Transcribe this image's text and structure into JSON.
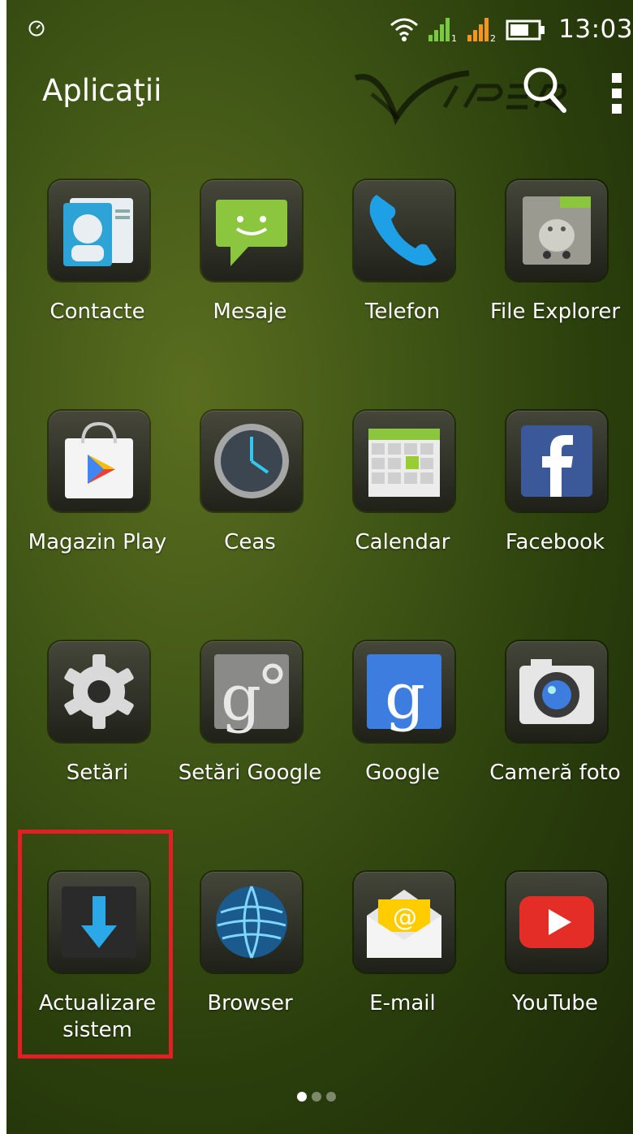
{
  "status_bar": {
    "time": "13:03",
    "left_icon": "speedometer-icon",
    "icons": [
      "wifi-icon",
      "signal-sim1-icon",
      "signal-sim2-icon",
      "battery-icon"
    ]
  },
  "action_bar": {
    "title": "Aplicaţii",
    "search_icon": "search-icon",
    "overflow_icon": "overflow-menu-icon"
  },
  "apps": [
    {
      "label": "Contacte",
      "icon": "contacts-icon"
    },
    {
      "label": "Mesaje",
      "icon": "messaging-icon"
    },
    {
      "label": "Telefon",
      "icon": "phone-icon"
    },
    {
      "label": "File Explorer",
      "icon": "file-explorer-icon"
    },
    {
      "label": "Magazin Play",
      "icon": "play-store-icon"
    },
    {
      "label": "Ceas",
      "icon": "clock-icon"
    },
    {
      "label": "Calendar",
      "icon": "calendar-icon"
    },
    {
      "label": "Facebook",
      "icon": "facebook-icon"
    },
    {
      "label": "Setări",
      "icon": "settings-gear-icon"
    },
    {
      "label": "Setări Google",
      "icon": "google-settings-icon"
    },
    {
      "label": "Google",
      "icon": "google-search-icon"
    },
    {
      "label": "Cameră foto",
      "icon": "camera-icon"
    },
    {
      "label": "Actualizare sistem",
      "icon": "system-update-icon"
    },
    {
      "label": "Browser",
      "icon": "browser-globe-icon"
    },
    {
      "label": "E-mail",
      "icon": "email-icon"
    },
    {
      "label": "YouTube",
      "icon": "youtube-icon"
    }
  ],
  "pager": {
    "pages": 3,
    "current": 1
  },
  "colors": {
    "highlight": "#e31e24",
    "wallpaper": "#3f5515"
  }
}
